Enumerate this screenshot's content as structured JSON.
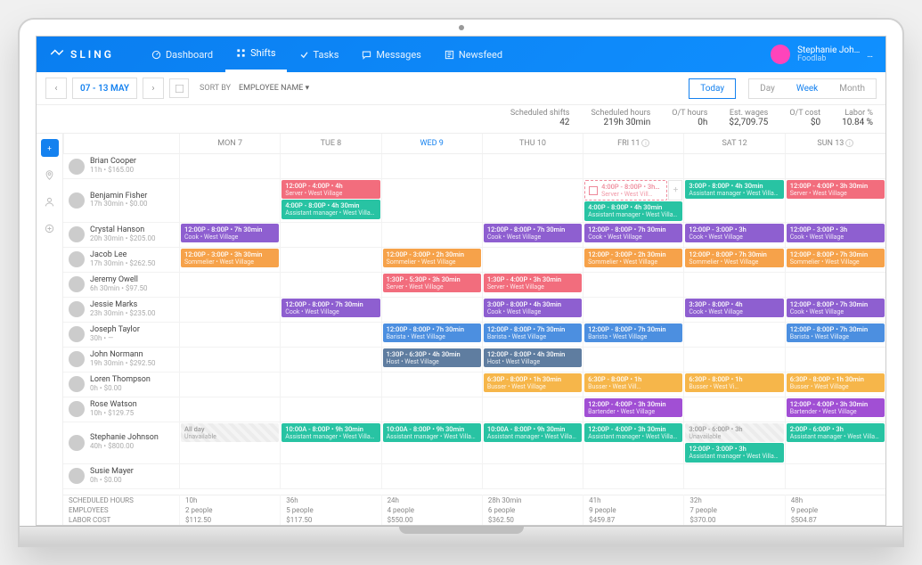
{
  "brand": "SLING",
  "nav": [
    {
      "label": "Dashboard",
      "icon": "gauge"
    },
    {
      "label": "Shifts",
      "icon": "grid",
      "active": true
    },
    {
      "label": "Tasks",
      "icon": "check"
    },
    {
      "label": "Messages",
      "icon": "chat"
    },
    {
      "label": "Newsfeed",
      "icon": "feed"
    }
  ],
  "user": {
    "name": "Stephanie Joh…",
    "org": "Foodlab"
  },
  "date_label": "07 - 13 MAY",
  "sort_by_label": "SORT BY",
  "sort_by_value": "EMPLOYEE NAME",
  "today_label": "Today",
  "range": [
    "Day",
    "Week",
    "Month"
  ],
  "range_active": "Week",
  "stats": [
    {
      "k": "Scheduled shifts",
      "v": "42"
    },
    {
      "k": "Scheduled hours",
      "v": "219h 30min"
    },
    {
      "k": "O/T hours",
      "v": "0h"
    },
    {
      "k": "Est. wages",
      "v": "$2,709.75"
    },
    {
      "k": "O/T cost",
      "v": "$0"
    },
    {
      "k": "Labor %",
      "v": "10.84 %"
    }
  ],
  "days": [
    "MON 7",
    "TUE 8",
    "WED 9",
    "THU 10",
    "FRI 11",
    "SAT 12",
    "SUN 13"
  ],
  "day_active_index": 2,
  "day_info_index": [
    4,
    6
  ],
  "colors": {
    "server": "#f26d7d",
    "asst": "#28c3a3",
    "cook": "#8e5fd0",
    "sommelier": "#f6a24a",
    "barista": "#4c8fe0",
    "host": "#5f7da0",
    "busser": "#f6b64a",
    "bartender": "#a14fd4"
  },
  "employees": [
    {
      "name": "Brian Cooper",
      "sub": "11h • $165.00",
      "shifts": {}
    },
    {
      "name": "Benjamin Fisher",
      "sub": "17h 30min • $0.00",
      "shifts": {
        "TUE 8": [
          {
            "t": "12:00P - 4:00P • 4h",
            "r": "Server • West Village",
            "c": "server"
          },
          {
            "t": "4:00P - 8:00P • 4h 30min",
            "r": "Assistant manager • West Villa…",
            "c": "asst"
          }
        ],
        "FRI 11": [
          {
            "t": "4:00P - 8:00P • 3h…",
            "r": "Server • West Vill…",
            "c": "server",
            "outline": true
          },
          {
            "t": "4:00P - 8:00P • 4h 30min",
            "r": "Assistant manager • West Villa…",
            "c": "asst"
          }
        ],
        "SAT 12": [
          {
            "t": "3:00P - 8:00P • 4h 30min",
            "r": "Assistant manager • West Villa…",
            "c": "asst"
          }
        ],
        "SUN 13": [
          {
            "t": "12:00P - 4:00P • 3h 30min",
            "r": "Server • West Village",
            "c": "server"
          }
        ]
      }
    },
    {
      "name": "Crystal Hanson",
      "sub": "20h 30min • $205.00",
      "shifts": {
        "MON 7": [
          {
            "t": "12:00P - 8:00P • 7h 30min",
            "r": "Cook • West Village",
            "c": "cook"
          }
        ],
        "THU 10": [
          {
            "t": "12:00P - 8:00P • 7h 30min",
            "r": "Cook • West Village",
            "c": "cook"
          }
        ],
        "FRI 11": [
          {
            "t": "12:00P - 8:00P • 7h 30min",
            "r": "Cook • West Village",
            "c": "cook"
          }
        ],
        "SAT 12": [
          {
            "t": "12:00P - 3:00P • 3h",
            "r": "Cook • West Village",
            "c": "cook"
          }
        ],
        "SUN 13": [
          {
            "t": "12:00P - 3:00P • 3h",
            "r": "Cook • West Village",
            "c": "cook"
          }
        ]
      }
    },
    {
      "name": "Jacob Lee",
      "sub": "17h 30min • $262.50",
      "shifts": {
        "MON 7": [
          {
            "t": "12:00P - 3:00P • 3h 30min",
            "r": "Sommelier • West Village",
            "c": "sommelier"
          }
        ],
        "WED 9": [
          {
            "t": "12:00P - 3:00P • 2h 30min",
            "r": "Sommelier • West Village",
            "c": "sommelier"
          }
        ],
        "FRI 11": [
          {
            "t": "12:00P - 3:00P • 2h 30min",
            "r": "Sommelier • West Village",
            "c": "sommelier"
          }
        ],
        "SAT 12": [
          {
            "t": "12:00P - 8:00P • 7h 30min",
            "r": "Sommelier • West Village",
            "c": "sommelier"
          }
        ],
        "SUN 13": [
          {
            "t": "12:00P - 8:00P • 7h 30min",
            "r": "Sommelier • West Village",
            "c": "sommelier"
          }
        ]
      }
    },
    {
      "name": "Jeremy Owell",
      "sub": "6h 30min • $97.50",
      "shifts": {
        "WED 9": [
          {
            "t": "1:30P - 5:30P • 3h 30min",
            "r": "Server • West Village",
            "c": "server"
          }
        ],
        "THU 10": [
          {
            "t": "1:30P - 4:00P • 3h 30min",
            "r": "Server • West Village",
            "c": "server"
          }
        ]
      }
    },
    {
      "name": "Jessie Marks",
      "sub": "23h 30min • $235.00",
      "shifts": {
        "TUE 8": [
          {
            "t": "12:00P - 8:00P • 7h 30min",
            "r": "Cook • West Village",
            "c": "cook"
          }
        ],
        "THU 10": [
          {
            "t": "3:00P - 8:00P • 4h 30min",
            "r": "Cook • West Village",
            "c": "cook"
          }
        ],
        "SAT 12": [
          {
            "t": "3:30P - 8:00P • 4h",
            "r": "Cook • West Village",
            "c": "cook"
          }
        ],
        "SUN 13": [
          {
            "t": "12:00P - 8:00P • 7h 30min",
            "r": "Cook • West Village",
            "c": "cook"
          }
        ]
      }
    },
    {
      "name": "Joseph Taylor",
      "sub": "30h • —",
      "shifts": {
        "WED 9": [
          {
            "t": "12:00P - 8:00P • 7h 30min",
            "r": "Barista • West Village",
            "c": "barista"
          }
        ],
        "THU 10": [
          {
            "t": "12:00P - 8:00P • 7h 30min",
            "r": "Barista • West Village",
            "c": "barista"
          }
        ],
        "FRI 11": [
          {
            "t": "12:00P - 8:00P • 7h 30min",
            "r": "Barista • West Village",
            "c": "barista"
          }
        ],
        "SUN 13": [
          {
            "t": "12:00P - 8:00P • 7h 30min",
            "r": "Barista • West Village",
            "c": "barista"
          }
        ]
      }
    },
    {
      "name": "John Normann",
      "sub": "19h 30min • $292.50",
      "shifts": {
        "WED 9": [
          {
            "t": "1:30P - 6:30P • 4h 30min",
            "r": "Host • West Village",
            "c": "host"
          }
        ],
        "THU 10": [
          {
            "t": "12:00P - 8:00P • 4h 30min",
            "r": "Host • West Village",
            "c": "host"
          }
        ]
      }
    },
    {
      "name": "Loren Thompson",
      "sub": "0h • $0.00",
      "shifts": {
        "THU 10": [
          {
            "t": "6:30P - 8:00P • 1h 30min",
            "r": "Busser • West Village",
            "c": "busser"
          }
        ],
        "FRI 11": [
          {
            "t": "6:30P - 8:00P • 1h",
            "r": "Busser • West Vill…",
            "c": "busser"
          }
        ],
        "SAT 12": [
          {
            "t": "6:30P - 8:00P • 1h",
            "r": "Busser • West Vi…",
            "c": "busser"
          }
        ],
        "SUN 13": [
          {
            "t": "6:30P - 8:00P • 1h 30min",
            "r": "Busser • West Village",
            "c": "busser"
          }
        ]
      }
    },
    {
      "name": "Rose Watson",
      "sub": "10h • $129.75",
      "shifts": {
        "FRI 11": [
          {
            "t": "12:00P - 4:00P • 3h 30min",
            "r": "Bartender • West Village",
            "c": "bartender"
          }
        ],
        "SUN 13": [
          {
            "t": "12:00P - 4:00P • 3h 30min",
            "r": "Bartender • West Village",
            "c": "bartender"
          }
        ]
      }
    },
    {
      "name": "Stephanie Johnson",
      "sub": "40h • $800.00",
      "shifts": {
        "MON 7": [
          {
            "t": "All day",
            "r": "Unavailable",
            "c": "unavail"
          }
        ],
        "TUE 8": [
          {
            "t": "10:00A - 8:00P • 9h 30min",
            "r": "Assistant manager • West Villa…",
            "c": "asst"
          }
        ],
        "WED 9": [
          {
            "t": "10:00A - 8:00P • 9h 30min",
            "r": "Assistant manager • West Villa…",
            "c": "asst"
          }
        ],
        "THU 10": [
          {
            "t": "10:00A - 8:00P • 9h 30min",
            "r": "Assistant manager • West Villa…",
            "c": "asst"
          }
        ],
        "FRI 11": [
          {
            "t": "12:00P - 4:00P • 3h 30min",
            "r": "Assistant manager • West Villa…",
            "c": "asst"
          }
        ],
        "SAT 12": [
          {
            "t": "3:00P - 6:00P • 3h",
            "r": "Unavailable",
            "c": "unavail"
          },
          {
            "t": "12:00P - 3:00P • 3h",
            "r": "Assistant manager • West Villa…",
            "c": "asst"
          }
        ],
        "SUN 13": [
          {
            "t": "2:00P - 6:00P • 3h",
            "r": "Assistant manager • West Villa…",
            "c": "asst"
          }
        ]
      }
    },
    {
      "name": "Susie Mayer",
      "sub": "0h • $0.00",
      "shifts": {}
    }
  ],
  "footer": {
    "labels": [
      "SCHEDULED HOURS",
      "EMPLOYEES",
      "LABOR COST"
    ],
    "cols": [
      [
        "10h",
        "2 people",
        "$112.50"
      ],
      [
        "36h",
        "5 people",
        "$117.50"
      ],
      [
        "24h",
        "4 people",
        "$550.00"
      ],
      [
        "28h 30min",
        "6 people",
        "$362.50"
      ],
      [
        "41h",
        "9 people",
        "$459.87"
      ],
      [
        "32h",
        "7 people",
        "$370.00"
      ],
      [
        "48h",
        "9 people",
        "$504.87"
      ]
    ]
  }
}
